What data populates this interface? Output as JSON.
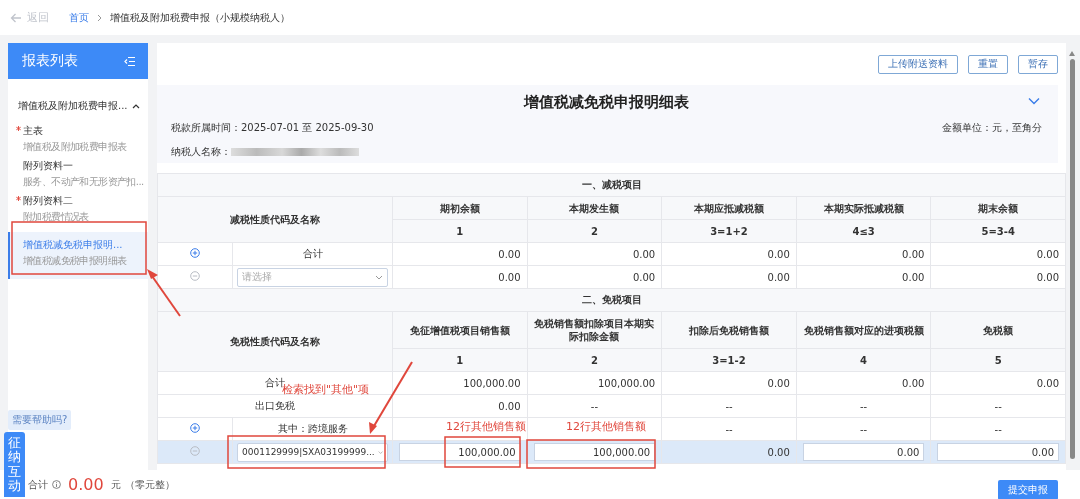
{
  "topbar": {
    "back": "返回",
    "breadcrumb": [
      {
        "label": "首页",
        "link": true
      },
      {
        "label": "增值税及附加税费申报（小规模纳税人）",
        "link": false
      }
    ]
  },
  "sidebar": {
    "title": "报表列表",
    "group": {
      "label": "增值税及附加税费申报...",
      "expanded": true
    },
    "items": [
      {
        "label": "主表",
        "sub": "增值税及附加税费申报表",
        "required": true,
        "selected": false
      },
      {
        "label": "附列资料一",
        "sub": "服务、不动产和无形资产扣...",
        "required": false,
        "selected": false
      },
      {
        "label": "附列资料二",
        "sub": "附加税费情况表",
        "required": true,
        "selected": false
      },
      {
        "label": "增值税减免税申报明...",
        "sub": "增值税减免税申报明细表",
        "required": false,
        "selected": true
      }
    ]
  },
  "toolbar": [
    "上传附送资料",
    "重置",
    "暂存"
  ],
  "form": {
    "title": "增值税减免税申报明细表",
    "expanded": true,
    "period_label": "税款所属时间：",
    "period": "2025-07-01 至 2025-09-30",
    "unit": "金额单位：元，至角分",
    "taxpayer_label": "纳税人名称：",
    "taxpayer_name_redacted": true
  },
  "sections": [
    {
      "title": "一、减税项目",
      "name_header": "减税性质代码及名称",
      "columns": [
        {
          "title": "期初余额",
          "code": "1"
        },
        {
          "title": "本期发生额",
          "code": "2"
        },
        {
          "title": "本期应抵减税额",
          "code": "3=1+2"
        },
        {
          "title": "本期实际抵减税额",
          "code": "4≤3"
        },
        {
          "title": "期末余额",
          "code": "5=3-4"
        }
      ],
      "rows": [
        {
          "kind": "group",
          "label": "合计",
          "selected": false,
          "cells": [
            {
              "kind": "text",
              "value": "0.00"
            },
            {
              "kind": "text",
              "value": "0.00"
            },
            {
              "kind": "text",
              "value": "0.00"
            },
            {
              "kind": "text",
              "value": "0.00"
            },
            {
              "kind": "text",
              "value": "0.00"
            }
          ]
        },
        {
          "kind": "select",
          "placeholder": "请选择",
          "selected": false,
          "cells": [
            {
              "kind": "text",
              "value": "0.00"
            },
            {
              "kind": "text",
              "value": "0.00"
            },
            {
              "kind": "text",
              "value": "0.00"
            },
            {
              "kind": "text",
              "value": "0.00"
            },
            {
              "kind": "text",
              "value": "0.00"
            }
          ]
        }
      ]
    },
    {
      "title": "二、免税项目",
      "name_header": "免税性质代码及名称",
      "columns": [
        {
          "title": "免征增值税项目销售额",
          "code": "1"
        },
        {
          "title": "免税销售额扣除项目本期实际扣除金额",
          "code": "2"
        },
        {
          "title": "扣除后免税销售额",
          "code": "3=1-2"
        },
        {
          "title": "免税销售额对应的进项税额",
          "code": "4"
        },
        {
          "title": "免税额",
          "code": "5"
        }
      ],
      "rows": [
        {
          "kind": "label",
          "label": "合计",
          "selected": false,
          "cells": [
            {
              "kind": "text",
              "value": "100,000.00"
            },
            {
              "kind": "text",
              "value": "100,000.00"
            },
            {
              "kind": "text",
              "value": "0.00"
            },
            {
              "kind": "text",
              "value": "0.00"
            },
            {
              "kind": "text",
              "value": "0.00"
            }
          ]
        },
        {
          "kind": "label",
          "label": "出口免税",
          "selected": false,
          "cells": [
            {
              "kind": "text",
              "value": "0.00"
            },
            {
              "kind": "dash",
              "value": "--"
            },
            {
              "kind": "dash",
              "value": "--"
            },
            {
              "kind": "dash",
              "value": "--"
            },
            {
              "kind": "dash",
              "value": "--"
            }
          ]
        },
        {
          "kind": "group",
          "label": "其中：跨境服务",
          "selected": false,
          "cells": [
            {
              "kind": "empty"
            },
            {
              "kind": "empty"
            },
            {
              "kind": "dash",
              "value": "--"
            },
            {
              "kind": "dash",
              "value": "--"
            },
            {
              "kind": "dash",
              "value": "--"
            }
          ]
        },
        {
          "kind": "select",
          "value": "0001129999|SXA03199999...",
          "selected": true,
          "cells": [
            {
              "kind": "input",
              "value": "100,000.00"
            },
            {
              "kind": "input",
              "value": "100,000.00"
            },
            {
              "kind": "text",
              "value": "0.00"
            },
            {
              "kind": "input",
              "value": "0.00"
            },
            {
              "kind": "input",
              "value": "0.00"
            }
          ]
        }
      ]
    }
  ],
  "footer": {
    "total_label": "合计",
    "total": "0.00",
    "unit": "元",
    "words": "（零元整）",
    "submit": "提交申报"
  },
  "help": {
    "bubble": "需要帮助吗?",
    "tab": "征纳互动"
  },
  "annotations": [
    "检索找到\"其他\"项",
    "12行其他销售额",
    "12行其他销售额"
  ]
}
